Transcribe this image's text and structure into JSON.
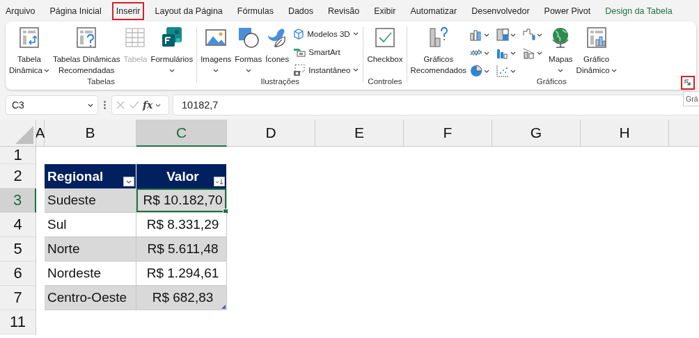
{
  "menu_tabs": [
    {
      "label": "Arquivo",
      "selected": false,
      "kind": "normal"
    },
    {
      "label": "Página Inicial",
      "selected": false,
      "kind": "normal"
    },
    {
      "label": "Inserir",
      "selected": true,
      "kind": "normal"
    },
    {
      "label": "Layout da Página",
      "selected": false,
      "kind": "normal"
    },
    {
      "label": "Fórmulas",
      "selected": false,
      "kind": "normal"
    },
    {
      "label": "Dados",
      "selected": false,
      "kind": "normal"
    },
    {
      "label": "Revisão",
      "selected": false,
      "kind": "normal"
    },
    {
      "label": "Exibir",
      "selected": false,
      "kind": "normal"
    },
    {
      "label": "Automatizar",
      "selected": false,
      "kind": "normal"
    },
    {
      "label": "Desenvolvedor",
      "selected": false,
      "kind": "normal"
    },
    {
      "label": "Power Pivot",
      "selected": false,
      "kind": "normal"
    },
    {
      "label": "Design da Tabela",
      "selected": false,
      "kind": "contextual"
    }
  ],
  "ribbon": {
    "groups": [
      {
        "label": "Tabelas",
        "items": [
          {
            "kind": "large",
            "lines": [
              "Tabela",
              "Dinâmica"
            ],
            "dropdown": true,
            "disabled": false
          },
          {
            "kind": "large",
            "lines": [
              "Tabelas Dinâmicas",
              "Recomendadas"
            ],
            "disabled": false
          },
          {
            "kind": "large",
            "lines": [
              "Tabela"
            ],
            "disabled": true
          },
          {
            "kind": "large",
            "lines": [
              "Formulários"
            ],
            "dropdown": true,
            "disabled": false
          }
        ]
      },
      {
        "label": "Ilustrações",
        "items": [
          {
            "kind": "large",
            "lines": [
              "Imagens"
            ],
            "dropdown": true,
            "disabled": false
          },
          {
            "kind": "large",
            "lines": [
              "Formas"
            ],
            "dropdown": true,
            "disabled": false
          },
          {
            "kind": "large",
            "lines": [
              "Ícones"
            ],
            "disabled": false
          },
          {
            "kind": "small",
            "label": "Modelos 3D",
            "dropdown": true,
            "disabled": false
          },
          {
            "kind": "small",
            "label": "SmartArt",
            "disabled": false
          },
          {
            "kind": "small",
            "label": "Instantâneo",
            "dropdown": true,
            "disabled": false
          }
        ]
      },
      {
        "label": "Controles",
        "items": [
          {
            "kind": "large",
            "lines": [
              "Checkbox"
            ],
            "disabled": false
          }
        ]
      },
      {
        "label": "Gráficos",
        "launcher_highlighted": true,
        "items": [
          {
            "kind": "large",
            "lines": [
              "Gráficos",
              "Recomendados"
            ],
            "disabled": false
          },
          {
            "kind": "icon",
            "dropdown": true,
            "disabled": false
          },
          {
            "kind": "icon",
            "dropdown": true,
            "disabled": false
          },
          {
            "kind": "icon",
            "dropdown": true,
            "disabled": false
          },
          {
            "kind": "icon",
            "dropdown": true,
            "disabled": false
          },
          {
            "kind": "icon",
            "dropdown": true,
            "disabled": false
          },
          {
            "kind": "icon",
            "dropdown": true,
            "disabled": false
          },
          {
            "kind": "icon",
            "dropdown": true,
            "disabled": false
          },
          {
            "kind": "icon",
            "dropdown": true,
            "disabled": false
          },
          {
            "kind": "large",
            "lines": [
              "Mapas"
            ],
            "dropdown": true,
            "disabled": false
          },
          {
            "kind": "large",
            "lines": [
              "Gráfico",
              "Dinâmico"
            ],
            "dropdown": true,
            "disabled": false
          }
        ]
      }
    ]
  },
  "tooltip": "Grá",
  "formula_bar": {
    "name_box": "C3",
    "fx_label": "fx",
    "formula": "10182,7"
  },
  "sheet": {
    "columns": [
      {
        "label": "A",
        "selected": false
      },
      {
        "label": "B",
        "selected": false
      },
      {
        "label": "C",
        "selected": true
      },
      {
        "label": "D",
        "selected": false
      },
      {
        "label": "E",
        "selected": false
      },
      {
        "label": "F",
        "selected": false
      },
      {
        "label": "G",
        "selected": false
      },
      {
        "label": "H",
        "selected": false
      }
    ],
    "rows": [
      {
        "label": "1",
        "selected": false
      },
      {
        "label": "2",
        "selected": false
      },
      {
        "label": "3",
        "selected": true
      },
      {
        "label": "4",
        "selected": false
      },
      {
        "label": "5",
        "selected": false
      },
      {
        "label": "6",
        "selected": false
      },
      {
        "label": "7",
        "selected": false
      },
      {
        "label": "11",
        "selected": false
      }
    ],
    "table": {
      "headers": [
        "Regional",
        "Valor"
      ],
      "rows": [
        {
          "region": "Sudeste",
          "value": "R$ 10.182,70",
          "selected": true
        },
        {
          "region": "Sul",
          "value": "R$ 8.331,29",
          "selected": false
        },
        {
          "region": "Norte",
          "value": "R$ 5.611,48",
          "selected": false
        },
        {
          "region": "Nordeste",
          "value": "R$ 1.294,61",
          "selected": false
        },
        {
          "region": "Centro-Oeste",
          "value": "R$ 682,83",
          "selected": false
        }
      ]
    }
  }
}
